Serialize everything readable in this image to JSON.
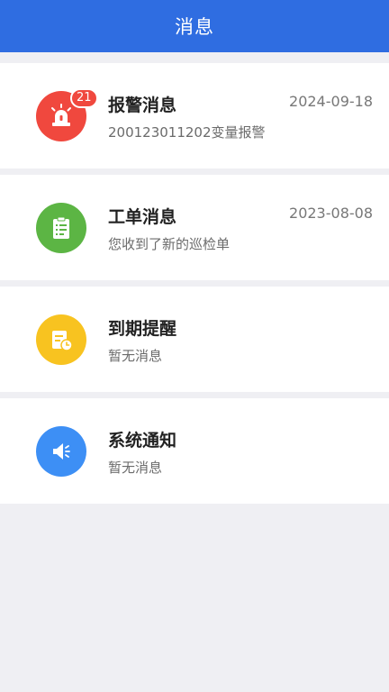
{
  "header": {
    "title": "消息"
  },
  "colors": {
    "header_bg": "#2f6de1",
    "alarm": "#f0483e",
    "workorder": "#5cb544",
    "expiry": "#f8c320",
    "system": "#3d8ff5",
    "badge": "#f0483e"
  },
  "messages": [
    {
      "id": "alarm",
      "icon": "siren-icon",
      "badge": "21",
      "title": "报警消息",
      "subtitle": "200123011202变量报警",
      "date": "2024-09-18"
    },
    {
      "id": "workorder",
      "icon": "clipboard-icon",
      "title": "工单消息",
      "subtitle": "您收到了新的巡检单",
      "date": "2023-08-08"
    },
    {
      "id": "expiry",
      "icon": "calendar-clock-icon",
      "title": "到期提醒",
      "subtitle": "暂无消息"
    },
    {
      "id": "system",
      "icon": "speaker-icon",
      "title": "系统通知",
      "subtitle": "暂无消息"
    }
  ]
}
